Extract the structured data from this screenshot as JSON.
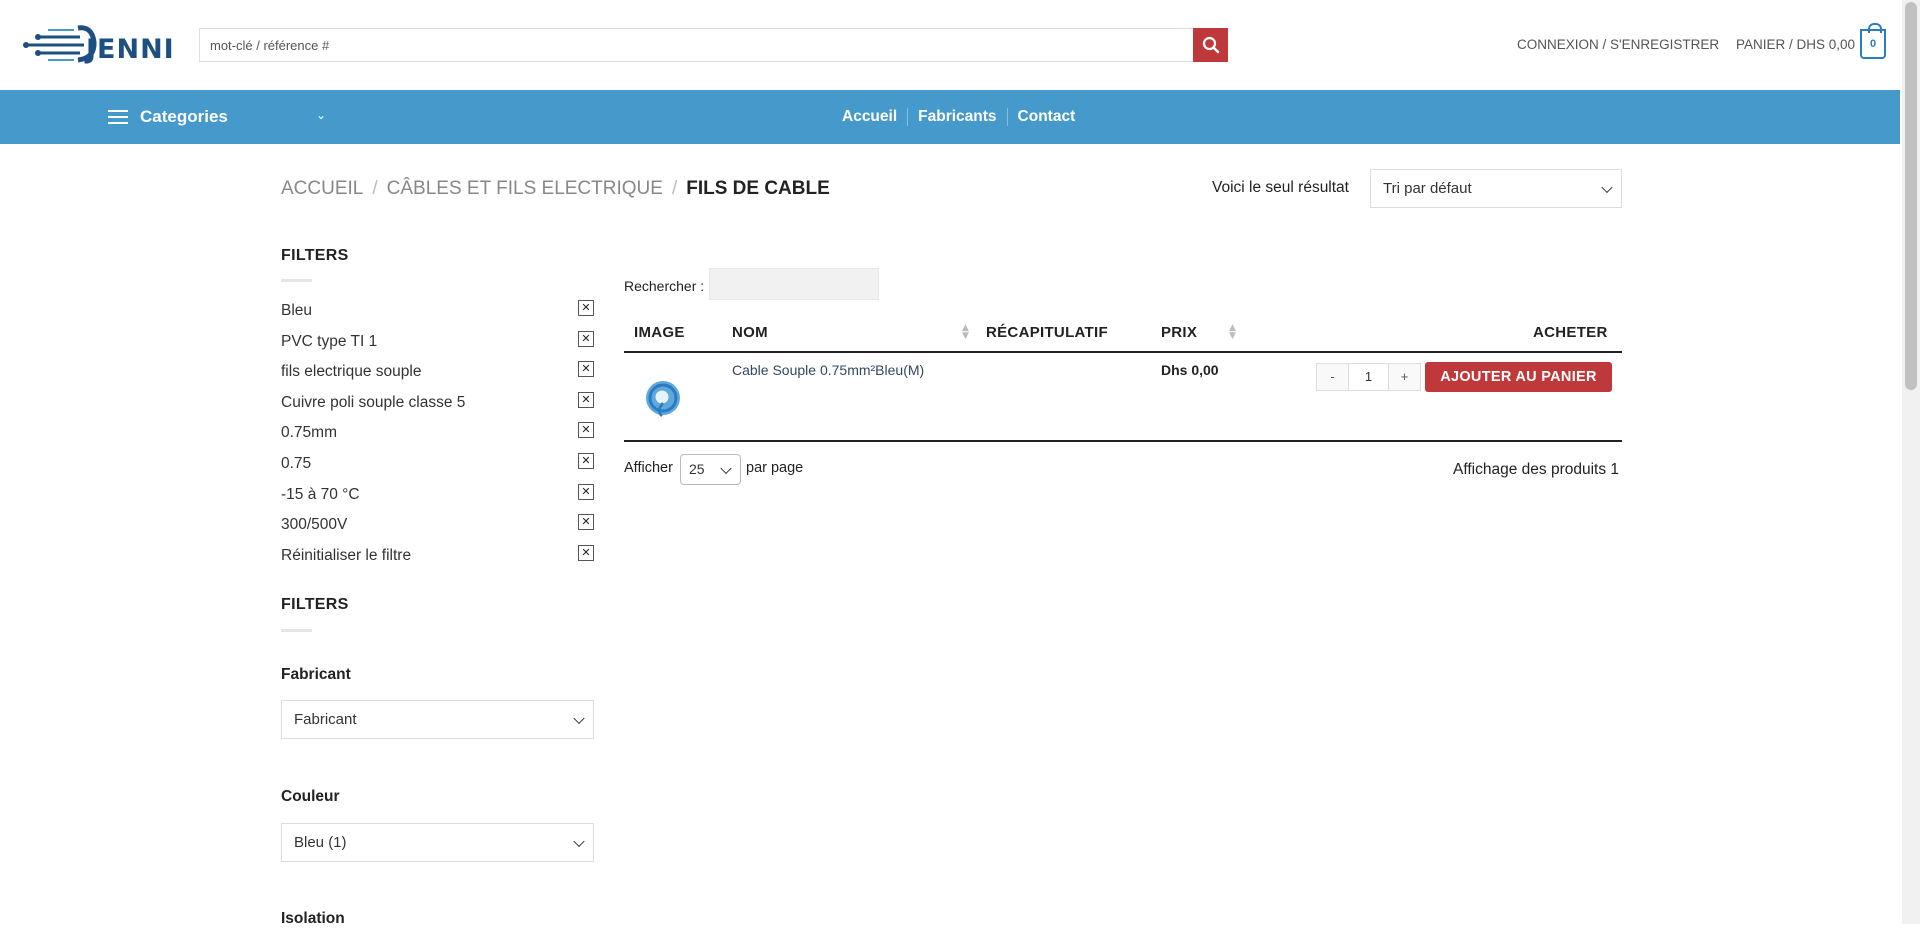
{
  "header": {
    "logo_text": "JENNI",
    "search_placeholder": "mot-clé / référence #",
    "login": "CONNEXION / S'ENREGISTRER",
    "cart": "PANIER / DHS 0,00",
    "cart_count": "0"
  },
  "nav": {
    "categories": "Categories",
    "links": [
      "Accueil",
      "Fabricants",
      "Contact"
    ]
  },
  "breadcrumb": {
    "items": [
      "ACCUEIL",
      "CÂBLES ET FILS ELECTRIQUE",
      "FILS DE CABLE"
    ],
    "separator": "/"
  },
  "result_count": "Voici le seul résultat",
  "sort": {
    "selected": "Tri par défaut"
  },
  "sidebar": {
    "filters_title_1": "FILTERS",
    "active_filters": [
      "Bleu",
      "PVC type TI 1",
      "fils electrique souple",
      "Cuivre poli souple classe 5",
      "0.75mm",
      "0.75",
      "-15 à 70 °C",
      "300/500V",
      "Réinitialiser le filtre"
    ],
    "remove_glyph": "✕",
    "filters_title_2": "FILTERS",
    "fabricant_label": "Fabricant",
    "fabricant_selected": "Fabricant",
    "couleur_label": "Couleur",
    "couleur_selected": "Bleu (1)",
    "isolation_label": "Isolation"
  },
  "table": {
    "search_label": "Rechercher :",
    "headers": {
      "image": "IMAGE",
      "name": "NOM",
      "summary": "RÉCAPITULATIF",
      "price": "PRIX",
      "buy": "ACHETER"
    },
    "rows": [
      {
        "name": "Cable Souple 0.75mm²Bleu(M)",
        "price": "Dhs 0,00",
        "qty_minus": "-",
        "qty": "1",
        "qty_plus": "+",
        "add_label": "AJOUTER AU PANIER"
      }
    ],
    "show_label": "Afficher",
    "per_page_selected": "25",
    "per_page_label": "par page",
    "info": "Affichage des produits 1"
  },
  "colors": {
    "nav_bg": "#4599cb",
    "accent_red": "#c0393a",
    "logo_blue": "#1d4f82",
    "cart_blue": "#2a7dbf"
  }
}
